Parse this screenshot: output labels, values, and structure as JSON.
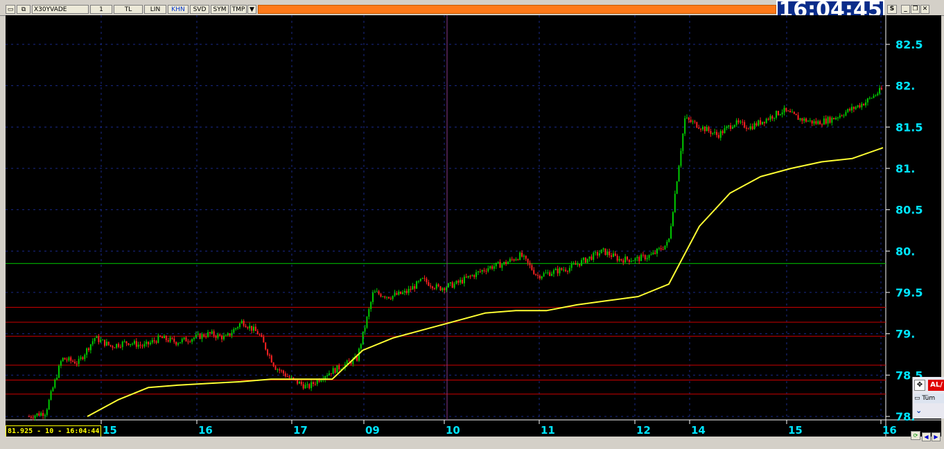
{
  "toolbar": {
    "symbol": "X30YVADE",
    "period": "1",
    "currency": "TL",
    "scale": "LIN",
    "khn": "KHN",
    "svd": "SVD",
    "sym": "SYM",
    "tmp": "TMP",
    "dropdown_glyph": "▼",
    "s_label": "S",
    "minimize": "_",
    "restore": "❐",
    "close": "✕"
  },
  "clock": "16:04:45",
  "readout": "81.925 - 10 - 16:04:44",
  "side_panel": {
    "al_label": "AL/",
    "tum_label": "Tüm",
    "expand_icon": "chevron-down-icon"
  },
  "colors": {
    "background": "#000000",
    "price_axis": "#00e5ff",
    "date_axis": "#00e5ff",
    "moving_average": "#ffff33",
    "h_line_green": "#00cc00",
    "h_line_red": "#cc0000",
    "candle_up": "#00cc00",
    "candle_down": "#ff2222"
  },
  "chart_data": {
    "type": "line",
    "y_ticks": [
      "82.5",
      "82.",
      "81.5",
      "81.",
      "80.5",
      "80.",
      "79.5",
      "79.",
      "78.5",
      "78."
    ],
    "ylim": [
      78,
      82.5
    ],
    "x_ticks": [
      "15",
      "16",
      "17",
      "09",
      "10",
      "11",
      "12",
      "14",
      "15",
      "16"
    ],
    "grid": true,
    "crosshair_x": "10",
    "series": [
      {
        "values_price": [
          78.0,
          78.05,
          78.7,
          78.65,
          78.95,
          78.85,
          78.9,
          78.85,
          78.95,
          78.9,
          78.95,
          79.0,
          78.95,
          79.15,
          79.0,
          78.6,
          78.45,
          78.35,
          78.5,
          78.6,
          78.7,
          79.5,
          79.45,
          79.5,
          79.65,
          79.55,
          79.6,
          79.7,
          79.8,
          79.85,
          79.95,
          79.7,
          79.75,
          79.8,
          79.9,
          80.0,
          79.9,
          79.9,
          79.95,
          80.1,
          81.6,
          81.5,
          81.4,
          81.55,
          81.5,
          81.6,
          81.7,
          81.6,
          81.55,
          81.6,
          81.7,
          81.8,
          81.95
        ]
      },
      {
        "values_ma": [
          78.0,
          78.2,
          78.35,
          78.38,
          78.4,
          78.42,
          78.45,
          78.45,
          78.45,
          78.8,
          78.95,
          79.05,
          79.15,
          79.25,
          79.28,
          79.28,
          79.35,
          79.4,
          79.45,
          79.6,
          80.3,
          80.7,
          80.9,
          81.0,
          81.08,
          81.12,
          81.25
        ]
      }
    ],
    "h_lines": [
      {
        "value": 79.85,
        "color": "green"
      },
      {
        "value": 79.32,
        "color": "red"
      },
      {
        "value": 79.14,
        "color": "red"
      },
      {
        "value": 78.97,
        "color": "red"
      },
      {
        "value": 78.62,
        "color": "red"
      },
      {
        "value": 78.44,
        "color": "red"
      },
      {
        "value": 78.27,
        "color": "red"
      }
    ]
  }
}
